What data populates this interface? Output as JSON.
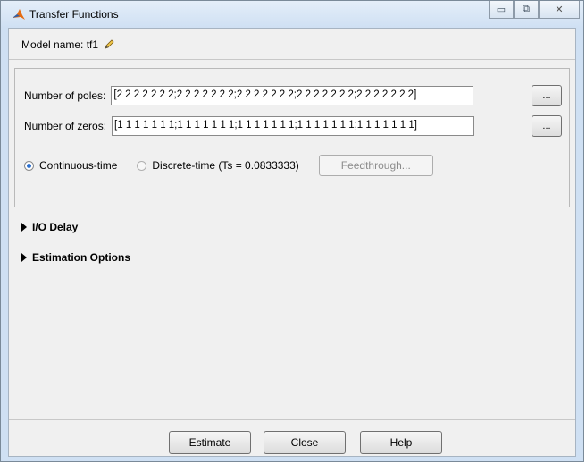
{
  "window": {
    "title": "Transfer Functions",
    "controls": {
      "minimize": "▭",
      "maximize": "⧉",
      "close": "✕"
    }
  },
  "model": {
    "label": "Model name: tf1",
    "icon": "pencil-icon"
  },
  "poles": {
    "label": "Number of poles:",
    "value": "[2 2 2 2 2 2 2;2 2 2 2 2 2 2;2 2 2 2 2 2 2;2 2 2 2 2 2 2;2 2 2 2 2 2 2]",
    "browse_label": "..."
  },
  "zeros": {
    "label": "Number of zeros:",
    "value": "[1 1 1 1 1 1 1;1 1 1 1 1 1 1;1 1 1 1 1 1 1;1 1 1 1 1 1 1;1 1 1 1 1 1 1]",
    "browse_label": "..."
  },
  "time_domain": {
    "continuous_label": "Continuous-time",
    "discrete_label": "Discrete-time (Ts = 0.0833333)",
    "selected": "continuous",
    "feedthrough_label": "Feedthrough..."
  },
  "sections": {
    "io_delay": "I/O Delay",
    "estimation_options": "Estimation Options"
  },
  "buttons": {
    "estimate": "Estimate",
    "close": "Close",
    "help": "Help"
  },
  "colors": {
    "accent": "#2a6fcf",
    "titlebar": "#cfe0f3",
    "panel": "#f0f0f0"
  }
}
